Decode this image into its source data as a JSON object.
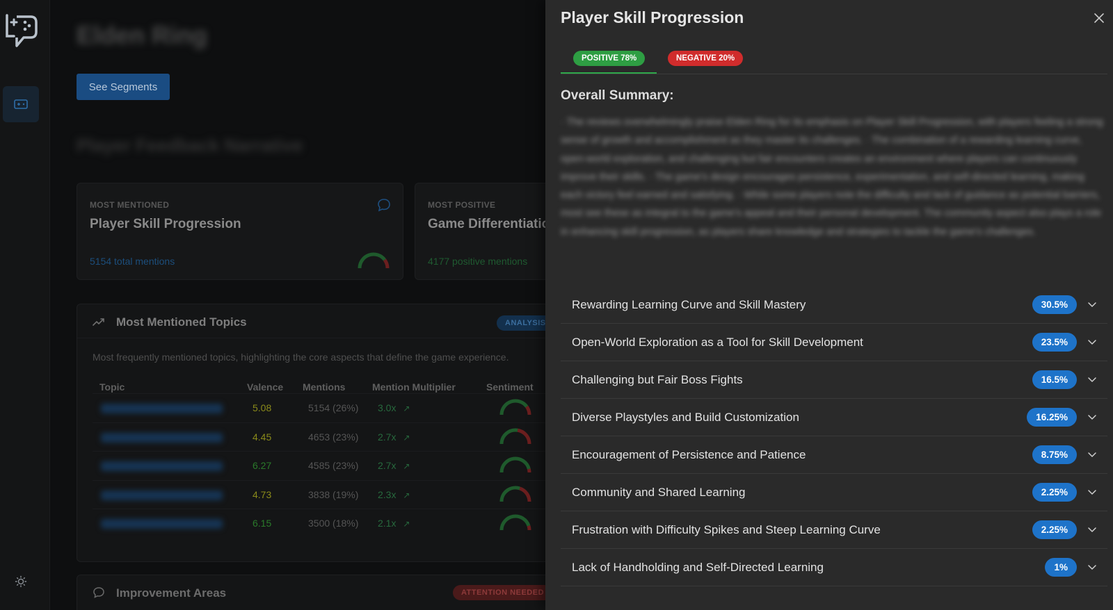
{
  "sidebar": {
    "logo_icon": "gamepad-chat-logo",
    "nav_icon": "gamepad-card-icon",
    "theme_icon": "sun-icon"
  },
  "dashboard": {
    "segments_button": "See Segments",
    "cards": [
      {
        "label": "MOST MENTIONED",
        "title": "Player Skill Progression",
        "sub": "5154 total mentions"
      },
      {
        "label": "MOST POSITIVE",
        "title": "Game Differentiatio",
        "sub": "4177 positive mentions"
      }
    ],
    "topics": {
      "title": "Most Mentioned Topics",
      "badge": "ANALYSIS",
      "description": "Most frequently mentioned topics, highlighting the core aspects that define the game experience.",
      "columns": [
        "Topic",
        "Valence",
        "Mentions",
        "Mention Multiplier",
        "Sentiment"
      ],
      "rows": [
        {
          "valence": "5.08",
          "mentions": "5154 (26%)",
          "multiplier": "3.0x",
          "valence_color": "#8a8a1a",
          "sentiment_positive": 0.8
        },
        {
          "valence": "4.45",
          "mentions": "4653 (23%)",
          "multiplier": "2.7x",
          "valence_color": "#8a8a1a",
          "sentiment_positive": 0.55
        },
        {
          "valence": "6.27",
          "mentions": "4585 (23%)",
          "multiplier": "2.7x",
          "valence_color": "#2a7a2a",
          "sentiment_positive": 0.92
        },
        {
          "valence": "4.73",
          "mentions": "3838 (19%)",
          "multiplier": "2.3x",
          "valence_color": "#8a8a1a",
          "sentiment_positive": 0.6
        },
        {
          "valence": "6.15",
          "mentions": "3500 (18%)",
          "multiplier": "2.1x",
          "valence_color": "#2a7a2a",
          "sentiment_positive": 0.9
        }
      ]
    },
    "improvement": {
      "title": "Improvement Areas",
      "badge": "ATTENTION NEEDED"
    }
  },
  "panel": {
    "title": "Player Skill Progression",
    "tabs": {
      "positive": "POSITIVE 78%",
      "negative": "NEGATIVE 20%"
    },
    "summary_heading": "Overall Summary:",
    "summary_text": "· The reviews overwhelmingly praise Elden Ring for its emphasis on Player Skill Progression, with players feeling a strong sense of growth and accomplishment as they master its challenges. · The combination of a rewarding learning curve, open-world exploration, and challenging but fair encounters creates an environment where players can continuously improve their skills. · The game's design encourages persistence, experimentation, and self-directed learning, making each victory feel earned and satisfying. · While some players note the difficulty and lack of guidance as potential barriers, most see these as integral to the game's appeal and their personal development. The community aspect also plays a role in enhancing skill progression, as players share knowledge and strategies to tackle the game's challenges.",
    "topics": [
      {
        "label": "Rewarding Learning Curve and Skill Mastery",
        "pct": "30.5%"
      },
      {
        "label": "Open-World Exploration as a Tool for Skill Development",
        "pct": "23.5%"
      },
      {
        "label": "Challenging but Fair Boss Fights",
        "pct": "16.5%"
      },
      {
        "label": "Diverse Playstyles and Build Customization",
        "pct": "16.25%"
      },
      {
        "label": "Encouragement of Persistence and Patience",
        "pct": "8.75%"
      },
      {
        "label": "Community and Shared Learning",
        "pct": "2.25%"
      },
      {
        "label": "Frustration with Difficulty Spikes and Steep Learning Curve",
        "pct": "2.25%"
      },
      {
        "label": "Lack of Handholding and Self-Directed Learning",
        "pct": "1%"
      }
    ]
  },
  "colors": {
    "positive": "#2e9e43",
    "negative": "#d02c2c",
    "badge_blue": "#1e73c9",
    "panel_bg": "#2a2a2a"
  }
}
